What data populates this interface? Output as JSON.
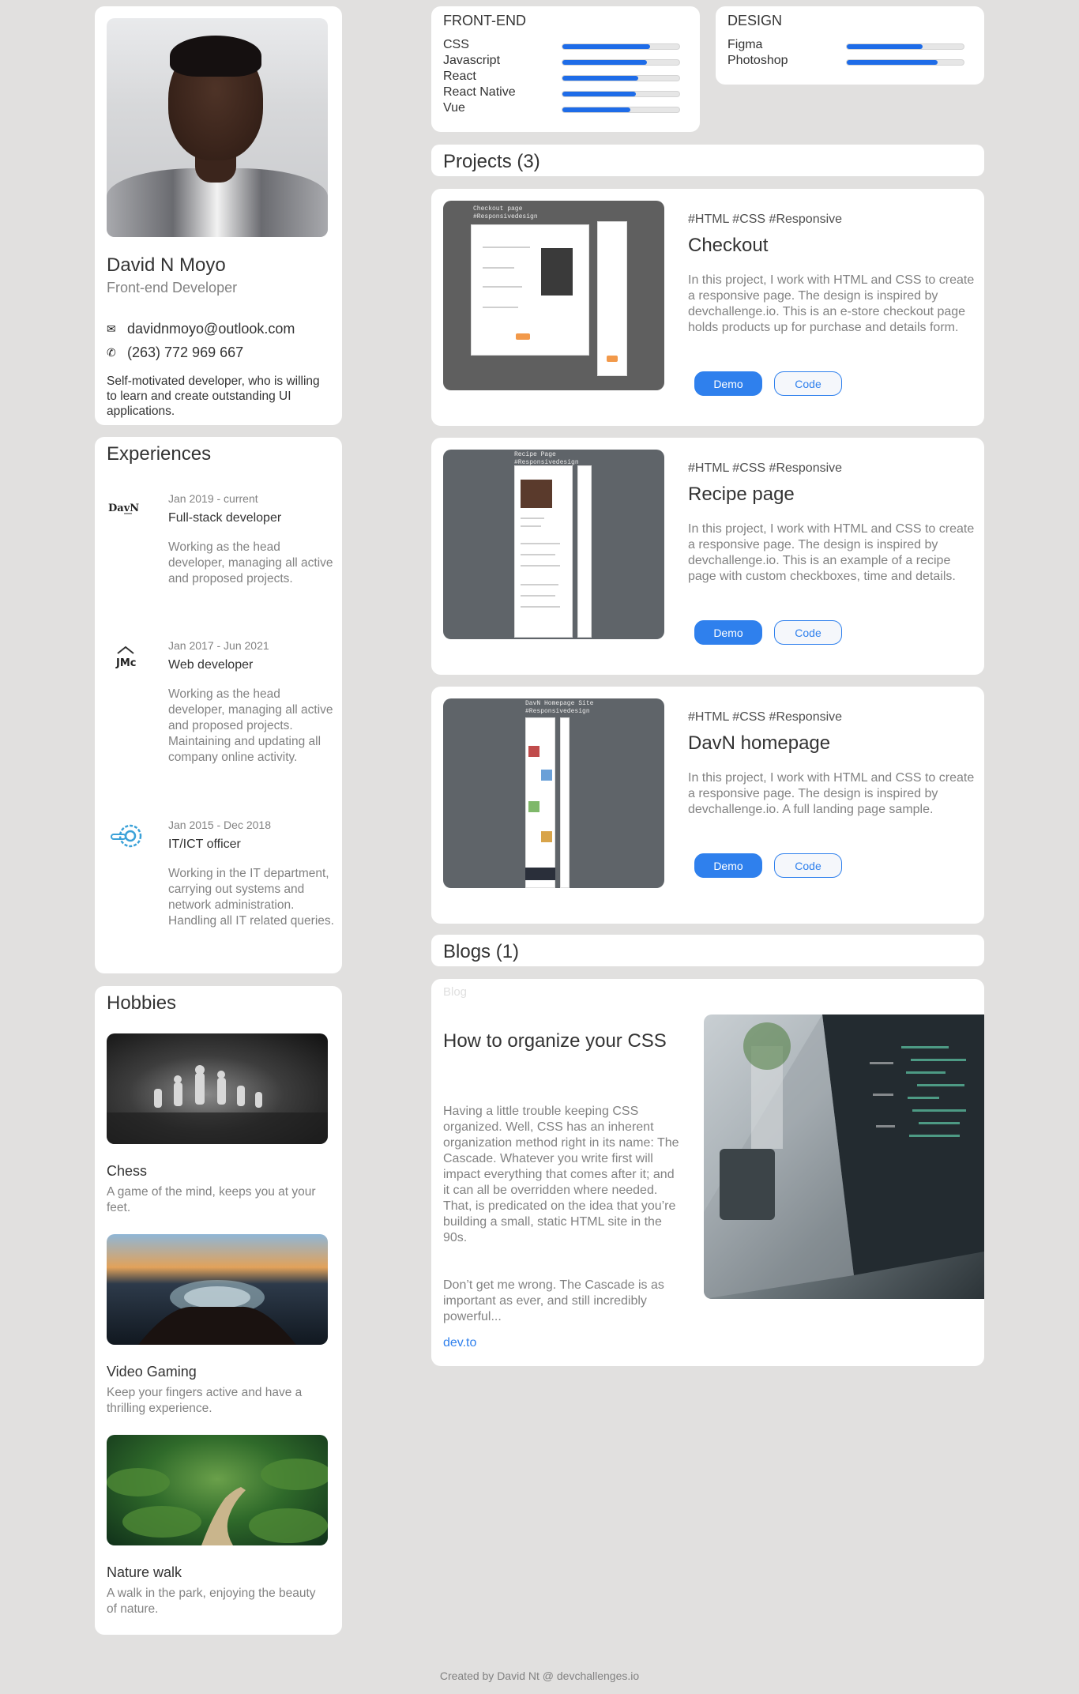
{
  "profile": {
    "name": "David N Moyo",
    "role": "Front-end Developer",
    "email": "davidnmoyo@outlook.com",
    "phone": "(263) 772 969 667",
    "bio": "Self-motivated developer, who is willing to learn and create outstanding UI applications."
  },
  "experiences": {
    "title": "Experiences",
    "items": [
      {
        "logo": "DavN",
        "date": "Jan 2019 - current",
        "title": "Full-stack developer",
        "desc": "Working as the head developer, managing all active and proposed projects."
      },
      {
        "logo": "JMc",
        "date": "Jan 2017 - Jun 2021",
        "title": "Web developer",
        "desc": "Working as the head developer, managing all active and proposed projects. Maintaining and updating all company online activity."
      },
      {
        "logo": "",
        "date": "Jan 2015 - Dec 2018",
        "title": "IT/ICT officer",
        "desc": "Working in the IT department, carrying out systems and network administration. Handling all IT related queries."
      }
    ]
  },
  "hobbies": {
    "title": "Hobbies",
    "items": [
      {
        "name": "Chess",
        "desc": "A game of the mind, keeps you at your feet."
      },
      {
        "name": "Video Gaming",
        "desc": "Keep your fingers active and have a thrilling experience."
      },
      {
        "name": "Nature walk",
        "desc": "A walk in the park, enjoying the beauty of nature."
      }
    ]
  },
  "skills": {
    "frontend": {
      "title": "FRONT-END",
      "items": [
        {
          "label": "CSS",
          "level": 0.75
        },
        {
          "label": "Javascript",
          "level": 0.72
        },
        {
          "label": "React",
          "level": 0.65
        },
        {
          "label": "React Native",
          "level": 0.63
        },
        {
          "label": "Vue",
          "level": 0.58
        }
      ]
    },
    "design": {
      "title": "DESIGN",
      "items": [
        {
          "label": "Figma",
          "level": 0.65
        },
        {
          "label": "Photoshop",
          "level": 0.78
        }
      ]
    }
  },
  "projects": {
    "heading": "Projects (3)",
    "items": [
      {
        "tags": "#HTML #CSS #Responsive",
        "title": "Checkout",
        "desc": "In this project, I work with HTML and CSS to create a responsive page. The design is inspired by devchallenge.io. This is an e-store checkout page holds products up for purchase and details form.",
        "demo": "Demo",
        "code": "Code",
        "shot_caption": "Checkout page\n#Responsivedesign"
      },
      {
        "tags": "#HTML #CSS #Responsive",
        "title": "Recipe page",
        "desc": "In this project, I work with HTML and CSS to create a responsive page. The design is inspired by devchallenge.io. This is an example of a recipe page with custom checkboxes, time and details.",
        "demo": "Demo",
        "code": "Code",
        "shot_caption": "Recipe Page\n#Responsivedesign"
      },
      {
        "tags": "#HTML #CSS #Responsive",
        "title": "DavN homepage",
        "desc": "In this project, I work with HTML and CSS to create a responsive page. The design is inspired by devchallenge.io. A full landing page sample.",
        "demo": "Demo",
        "code": "Code",
        "shot_caption": "DavN Homepage Site\n#Responsivedesign"
      }
    ]
  },
  "blogs": {
    "heading": "Blogs (1)",
    "item": {
      "tag": "Blog",
      "title": "How to organize your CSS",
      "p1": "Having a little trouble keeping CSS organized. Well, CSS has an inherent organization method right in its name: The Cascade. Whatever you write first will impact everything that comes after it; and it can all be overridden where needed. That, is predicated on the idea that you’re building a small, static HTML site in the 90s.",
      "p2": "Don’t get me wrong. The Cascade is as important as ever, and still incredibly powerful...",
      "link": "dev.to"
    }
  },
  "footer": "Created by David Nt @ devchallenges.io",
  "colors": {
    "accent": "#2f80ed",
    "bar": "#1e6ce8",
    "background": "#e1e0df"
  }
}
